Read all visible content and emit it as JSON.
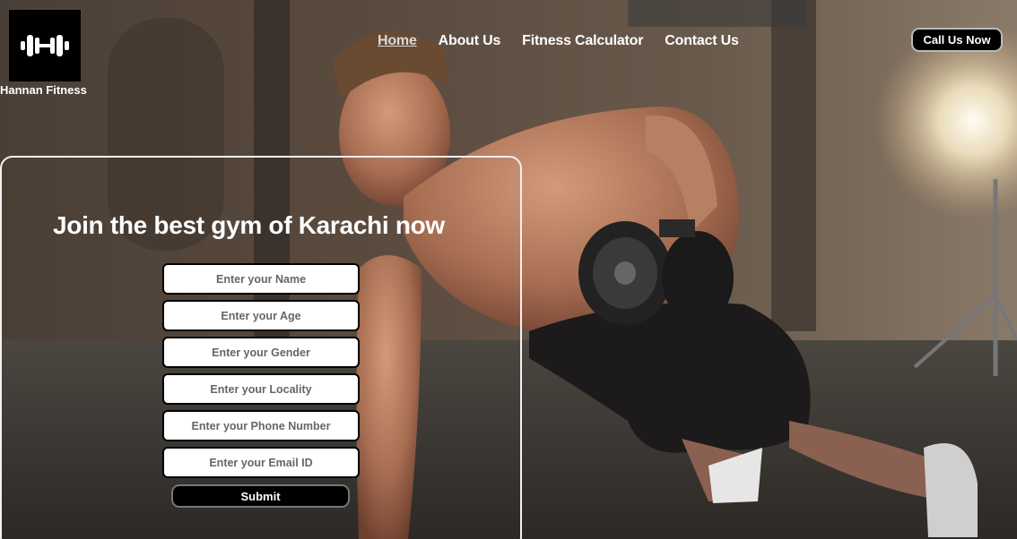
{
  "brand": {
    "name": "Hannan Fitness",
    "logo_icon": "dumbbell-icon"
  },
  "nav": {
    "items": [
      {
        "label": "Home",
        "active": true
      },
      {
        "label": "About Us",
        "active": false
      },
      {
        "label": "Fitness Calculator",
        "active": false
      },
      {
        "label": "Contact Us",
        "active": false
      }
    ]
  },
  "call_button": {
    "label": "Call Us Now"
  },
  "hero": {
    "headline": "Join the best gym of Karachi now"
  },
  "form": {
    "fields": [
      {
        "placeholder": "Enter your Name",
        "value": ""
      },
      {
        "placeholder": "Enter your Age",
        "value": ""
      },
      {
        "placeholder": "Enter your Gender",
        "value": ""
      },
      {
        "placeholder": "Enter your Locality",
        "value": ""
      },
      {
        "placeholder": "Enter your Phone Number",
        "value": ""
      },
      {
        "placeholder": "Enter your Email ID",
        "value": ""
      }
    ],
    "submit_label": "Submit"
  },
  "colors": {
    "button_bg": "#000000",
    "text": "#ffffff",
    "panel_border": "#f2f2f2"
  }
}
